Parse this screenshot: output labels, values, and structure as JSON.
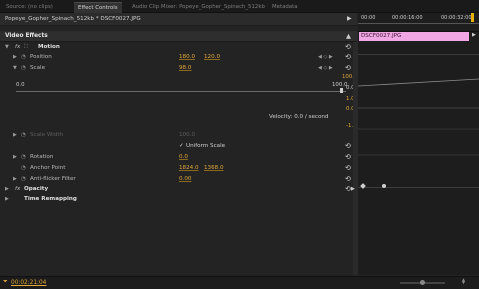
{
  "tabs": {
    "source": "Source: (no clips)",
    "effect_controls": "Effect Controls",
    "audio_clip_mixer": "Audio Clip Mixer: Popeye_Gopher_Spinach_512kb",
    "metadata": "Metadata"
  },
  "clip_header": "Popeye_Gopher_Spinach_512kb * DSCF0027.JPG",
  "timeline": {
    "time_start": "00:00",
    "time_mid": "00:00:16:00",
    "time_end": "00:00:32:00",
    "clip_label": "DSCF0027.JPG",
    "graph_top": "100.0",
    "graph_bottom": "0.0",
    "velocity_top": "1.0",
    "velocity_mid": "0.0",
    "velocity_bottom": "-1.0"
  },
  "section_title": "Video Effects",
  "motion": {
    "label": "Motion",
    "position": {
      "label": "Position",
      "x": "180.0",
      "y": "120.0"
    },
    "scale": {
      "label": "Scale",
      "value": "98.0",
      "graph_min": "0.0",
      "graph_max": "100.0",
      "velocity": "Velocity: 0.0 / second"
    },
    "scale_width": {
      "label": "Scale Width",
      "value": "100.0"
    },
    "uniform_scale": {
      "label": "Uniform Scale",
      "checked": true
    },
    "rotation": {
      "label": "Rotation",
      "value": "0.0"
    },
    "anchor_point": {
      "label": "Anchor Point",
      "x": "1824.0",
      "y": "1368.0"
    },
    "anti_flicker": {
      "label": "Anti-flicker Filter",
      "value": "0.00"
    }
  },
  "opacity": {
    "label": "Opacity"
  },
  "time_remapping": {
    "label": "Time Remapping"
  },
  "timecode": "00:02:21:04",
  "colors": {
    "accent_value": "#e3a93a",
    "clip_fill": "#f0a6e3",
    "panel_bg": "#232323"
  }
}
